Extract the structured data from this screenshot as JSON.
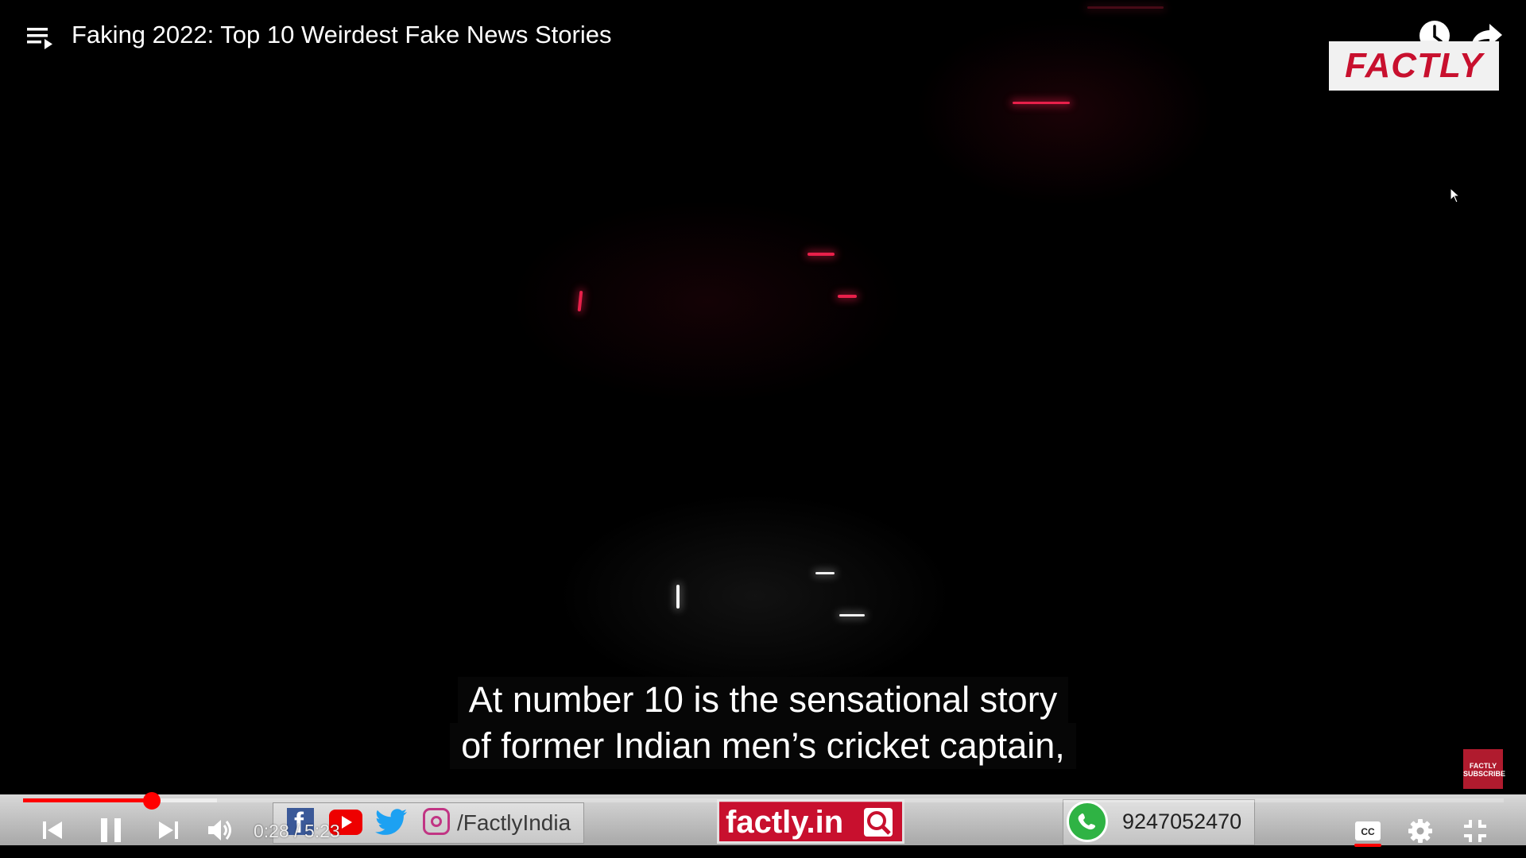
{
  "player": {
    "title": "Faking 2022: Top 10 Weirdest Fake News Stories",
    "watermark_logo": "FACTLY",
    "subscribe_watermark": "FACTLY SUBSCRIBE",
    "captions": [
      "At number 10 is the sensational story",
      "of former Indian men’s cricket captain,"
    ],
    "time": {
      "current": "0:28",
      "separator": " / ",
      "duration": "5:23"
    },
    "progress": {
      "played_fraction": 0.087,
      "loaded_fraction": 0.131
    },
    "colors": {
      "accent": "#ff0000",
      "brand_red": "#c8102e"
    }
  },
  "banner": {
    "social_handle": "/FactlyIndia",
    "website": "factly.in",
    "whatsapp_number": "9247052470",
    "icons": [
      "facebook-icon",
      "youtube-icon",
      "twitter-icon",
      "instagram-icon",
      "whatsapp-icon"
    ]
  },
  "controls": {
    "icons": [
      "previous-icon",
      "pause-icon",
      "next-icon",
      "volume-icon",
      "captions-icon",
      "settings-icon",
      "exit-fullscreen-icon"
    ]
  }
}
